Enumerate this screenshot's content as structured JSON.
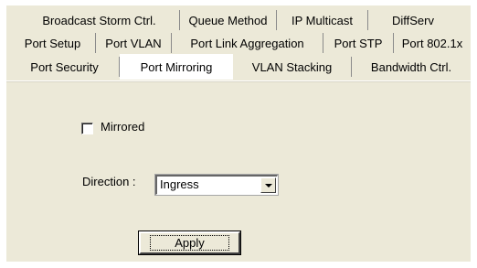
{
  "tabs": {
    "row1": [
      "Broadcast Storm Ctrl.",
      "Queue Method",
      "IP Multicast",
      "DiffServ"
    ],
    "row2": [
      "Port Setup",
      "Port VLAN",
      "Port Link Aggregation",
      "Port STP",
      "Port 802.1x"
    ],
    "row3": [
      "Port Security",
      "Port Mirroring",
      "VLAN Stacking",
      "Bandwidth Ctrl."
    ],
    "active": "Port Mirroring"
  },
  "form": {
    "mirrored_label": "Mirrored",
    "mirrored_checked": false,
    "direction_label": "Direction :",
    "direction_value": "Ingress",
    "apply_label": "Apply"
  }
}
